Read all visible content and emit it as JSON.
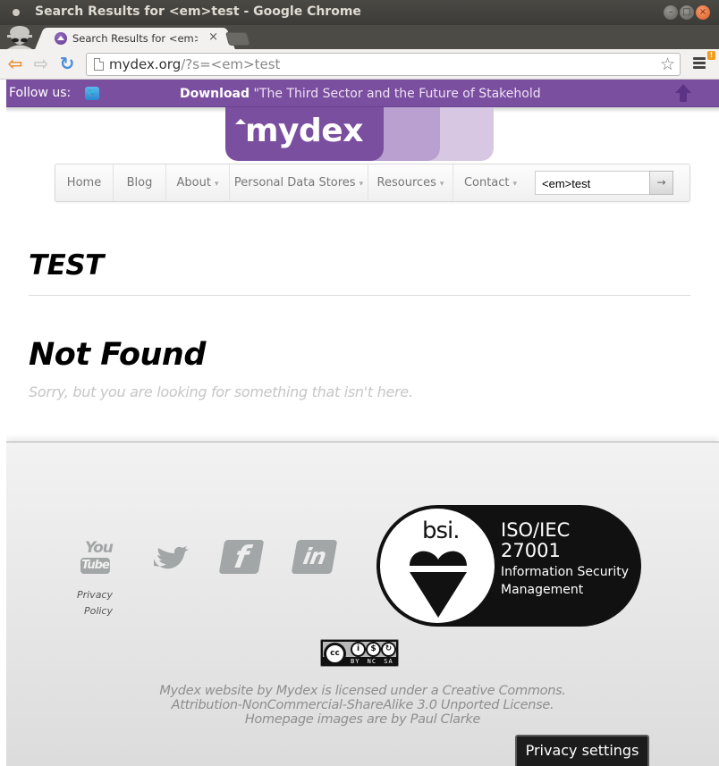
{
  "window": {
    "title": "Search Results for <em>test - Google Chrome",
    "buttons": [
      "minimize",
      "maximize",
      "close"
    ]
  },
  "tab": {
    "label": "Search Results for <em>",
    "close_glyph": "×"
  },
  "toolbar": {
    "url_host": "mydex.org",
    "url_rest": "/?s=<em>test",
    "menu_badge": "!"
  },
  "follow_bar": {
    "follow_label": "Follow us:",
    "download_bold": "Download",
    "download_text": " \"The Third Sector and the Future of Stakeholder E"
  },
  "logo": {
    "text": "mydex"
  },
  "nav": {
    "items": [
      {
        "label": "Home",
        "dropdown": false
      },
      {
        "label": "Blog",
        "dropdown": false
      },
      {
        "label": "About",
        "dropdown": true
      },
      {
        "label": "Personal Data Stores",
        "dropdown": true
      },
      {
        "label": "Resources",
        "dropdown": true
      },
      {
        "label": "Contact",
        "dropdown": true
      }
    ],
    "dropdown_glyph": "▾",
    "search_value": "<em>test",
    "search_button": "→"
  },
  "content": {
    "search_title": "TEST",
    "not_found_title": "Not Found",
    "not_found_text": "Sorry, but you are looking for something that isn't here."
  },
  "footer": {
    "social": {
      "youtube_top": "You",
      "youtube_bottom": "Tube",
      "facebook": "f",
      "linkedin": "in"
    },
    "privacy_policy": [
      "Privacy",
      "Policy"
    ],
    "bsi": {
      "brand": "bsi.",
      "standard_line1": "ISO/IEC",
      "standard_line2": "27001",
      "desc_line1": "Information Security",
      "desc_line2": "Management"
    },
    "cc_badge": {
      "cc": "cc",
      "labels": "BY NC SA"
    },
    "license_lines": [
      "Mydex website by Mydex is licensed under a Creative Commons.",
      "Attribution-NonCommercial-ShareAlike 3.0 Unported License.",
      "Homepage images are by Paul Clarke"
    ]
  },
  "privacy_settings": "Privacy settings",
  "colors": {
    "brand_purple": "#7b4fa0",
    "chrome_dark": "#3c3b37",
    "close_orange": "#e05a23"
  }
}
